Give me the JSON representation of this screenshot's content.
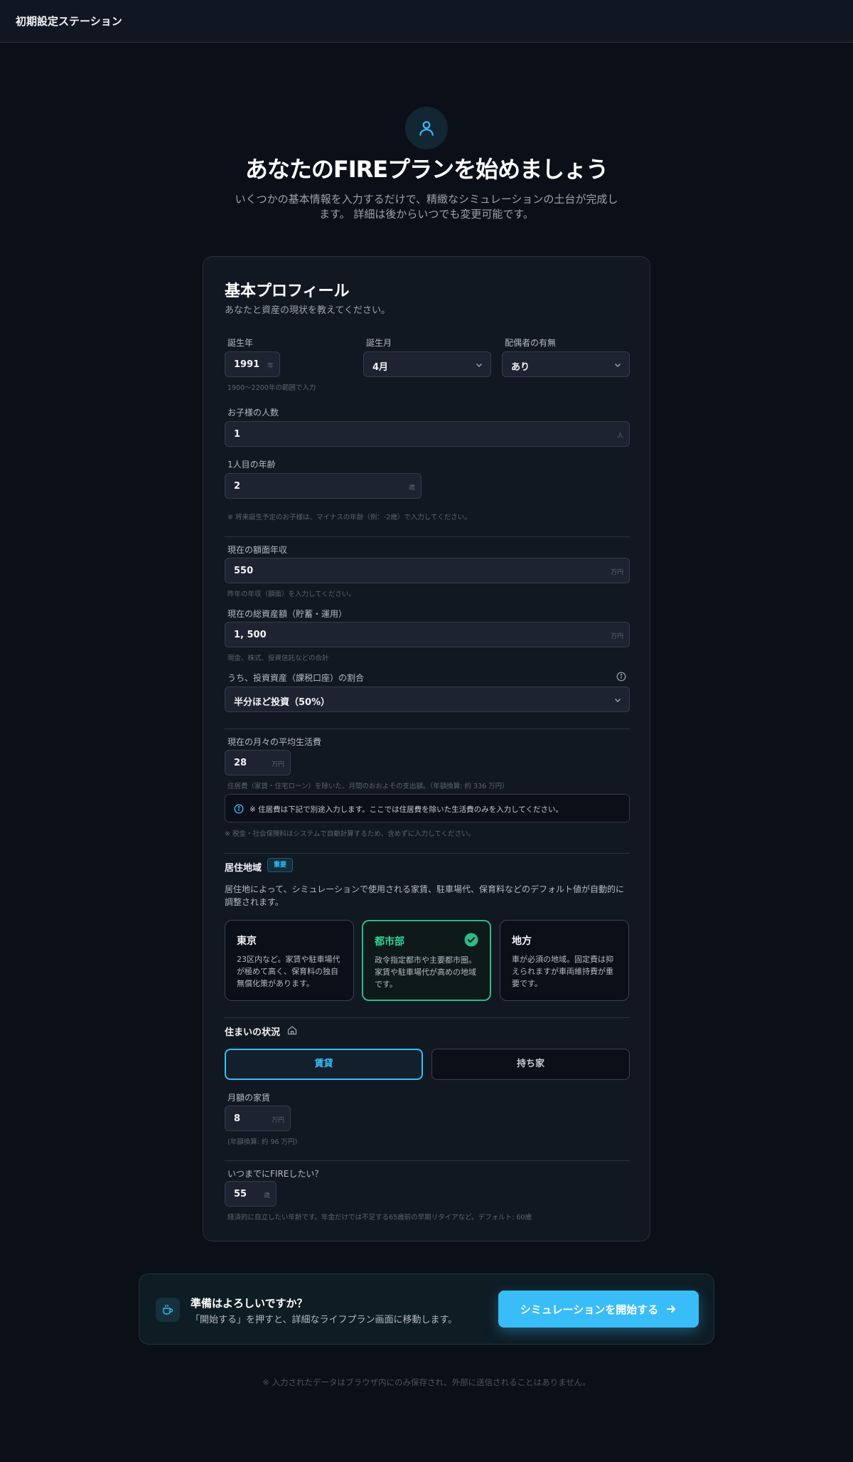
{
  "app": {
    "title": "初期設定ステーション"
  },
  "hero": {
    "icon": "user-icon",
    "title": "あなたのFIREプランを始めましょう",
    "subtitle_line1": "いくつかの基本情報を入力するだけで、精緻なシミュレーションの土台が完成し",
    "subtitle_line2": "ます。 詳細は後からいつでも変更可能です。"
  },
  "profile": {
    "title": "基本プロフィール",
    "subtitle": "あなたと資産の現状を教えてください。",
    "birth_year": {
      "label": "誕生年",
      "value": "1991",
      "unit": "年",
      "hint": "1900〜2200年の範囲で入力"
    },
    "birth_month": {
      "label": "誕生月",
      "value": "4月"
    },
    "spouse": {
      "label": "配偶者の有無",
      "value": "あり"
    },
    "children": {
      "label": "お子様の人数",
      "value": "1",
      "unit": "人"
    },
    "child1_age": {
      "label": "1人目の年齢",
      "value": "2",
      "unit": "歳",
      "hint": "※ 将来誕生予定のお子様は、マイナスの年齢（例：-2歳）で入力してください。"
    },
    "income": {
      "label": "現在の額面年収",
      "value": "550",
      "unit": "万円",
      "hint": "昨年の年収（額面）を入力してください。"
    },
    "assets": {
      "label": "現在の総資産額（貯蓄・運用）",
      "value": "1, 500",
      "unit": "万円",
      "hint": "現金、株式、投資信託などの合計"
    },
    "invest_ratio": {
      "label": "うち、投資資産（課税口座）の割合",
      "value": "半分ほど投資（50%）",
      "info_icon": "info-icon"
    },
    "living_cost": {
      "label": "現在の月々の平均生活費",
      "value": "28",
      "unit": "万円",
      "hint": "住居費（家賃・住宅ローン）を除いた、月間のおおよその支出額。（年額換算: 約 336 万円）",
      "note": "※ 住居費は下記で別途入力します。ここでは住居費を除いた生活費のみを入力してください。",
      "tax_note": "※ 税金・社会保険料はシステムで自動計算するため、含めずに入力してください。"
    },
    "region": {
      "title": "居住地域",
      "badge": "重要",
      "desc": "居住地によって、シミュレーションで使用される家賃、駐車場代、保育料などのデフォルト値が自動的に調整されます。",
      "options": [
        {
          "title": "東京",
          "desc": "23区内など。家賃や駐車場代が極めて高く、保育料の独自無償化策があります。"
        },
        {
          "title": "都市部",
          "desc": "政令指定都市や主要都市圏。家賃や駐車場代が高めの地域です。"
        },
        {
          "title": "地方",
          "desc": "車が必須の地域。固定費は抑えられますが車両維持費が重要です。"
        }
      ]
    },
    "housing": {
      "title": "住まいの状況",
      "icon": "home-icon",
      "options": [
        "賃貸",
        "持ち家"
      ],
      "rent": {
        "label": "月額の家賃",
        "value": "8",
        "unit": "万円",
        "hint": "(年額換算: 約 96 万円)"
      }
    },
    "fire_age": {
      "label": "いつまでにFIREしたい？",
      "value": "55",
      "unit": "歳",
      "hint": "経済的に自立したい年齢です。年金だけでは不足する65歳前の早期リタイアなど。デフォルト: 60歳"
    }
  },
  "cta": {
    "icon": "coffee-icon",
    "title": "準備はよろしいですか？",
    "subtitle": "「開始する」を押すと、詳細なライフプラン画面に移動します。",
    "button": "シミュレーションを開始する"
  },
  "footer": {
    "note": "※ 入力されたデータはブラウザ内にのみ保存され、外部に送信されることはありません。"
  },
  "colors": {
    "accent": "#38bdf8",
    "selected": "#34d399",
    "background": "#0b0f17"
  }
}
